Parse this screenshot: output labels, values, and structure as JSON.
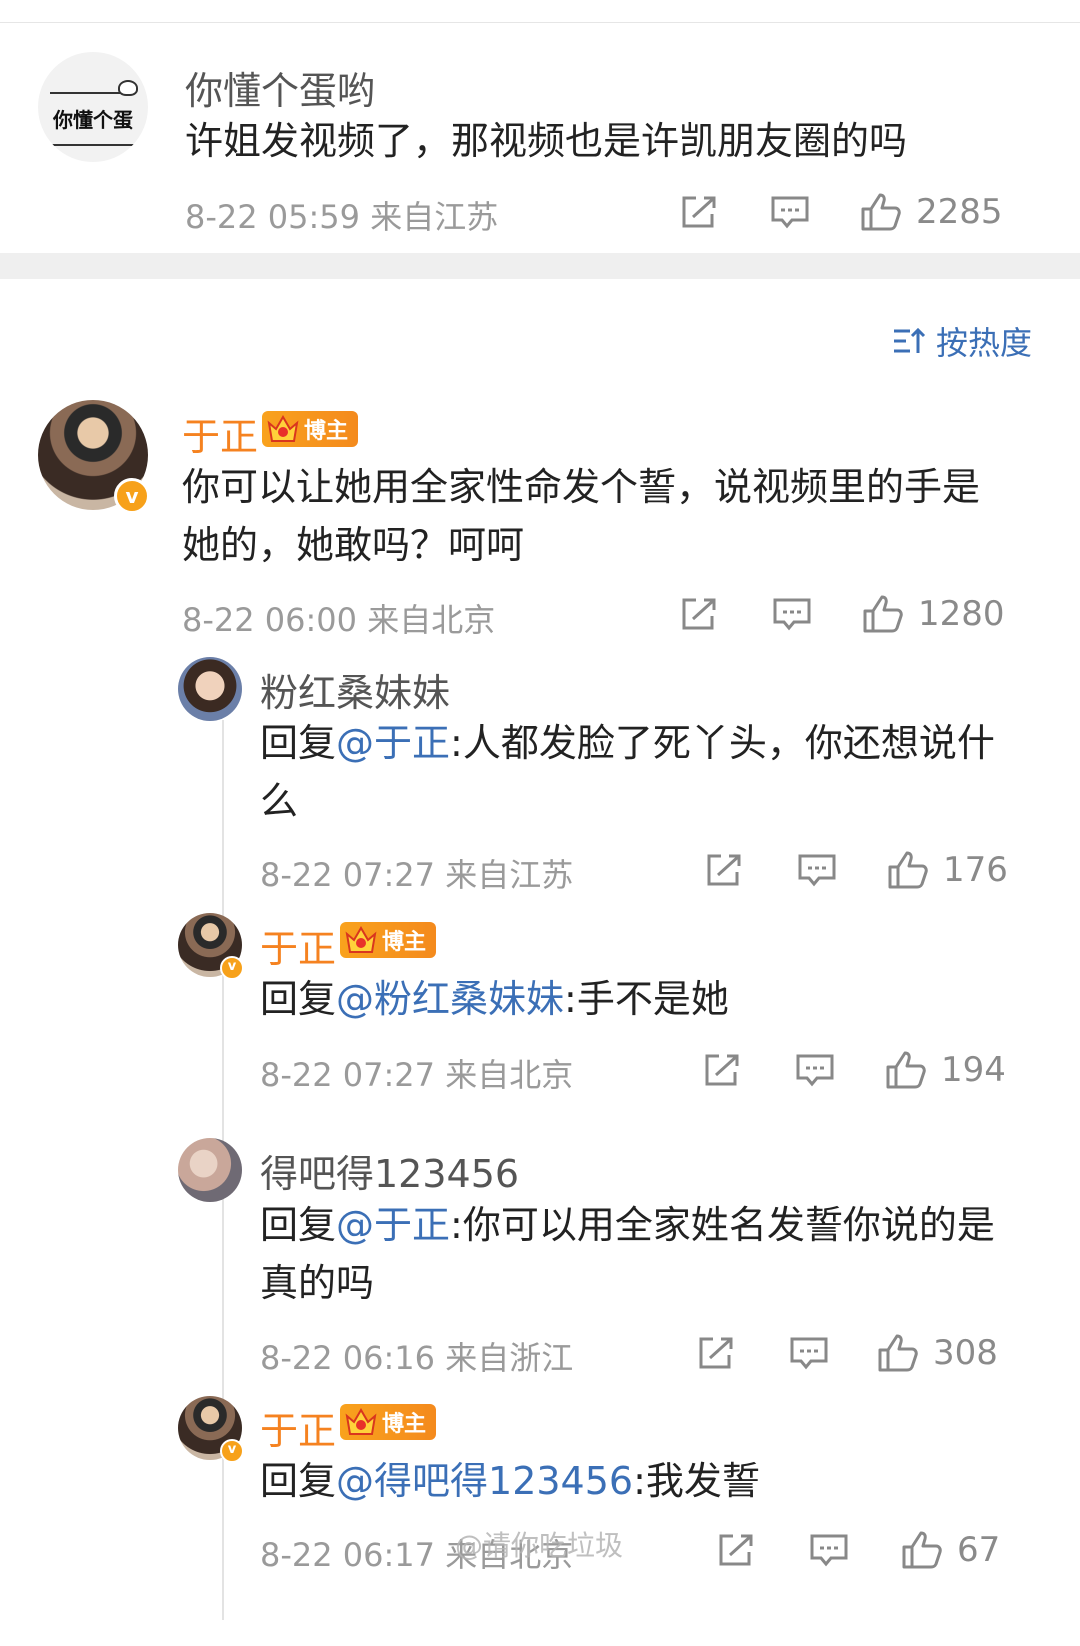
{
  "top_comment": {
    "avatar_text": "你懂个蛋",
    "name": "你懂个蛋哟",
    "text": "许姐发视频了，那视频也是许凯朋友圈的吗",
    "meta": "8-22 05:59  来自江苏",
    "likes": "2285"
  },
  "sort": {
    "label": "按热度"
  },
  "main_comment": {
    "name": "于正",
    "badge": "博主",
    "text": "你可以让她用全家性命发个誓，说视频里的手是她的，她敢吗？呵呵",
    "meta": "8-22 06:00  来自北京",
    "likes": "1280"
  },
  "replies": [
    {
      "name": "粉红桑妹妹",
      "prefix": "回复",
      "mention": "@于正",
      "text": ":人都发脸了死丫头，你还想说什么",
      "meta": "8-22 07:27  来自江苏",
      "likes": "176"
    },
    {
      "name": "于正",
      "badge": "博主",
      "prefix": "回复",
      "mention": "@粉红桑妹妹",
      "text": ":手不是她",
      "meta": "8-22 07:27  来自北京",
      "likes": "194"
    },
    {
      "name": "得吧得123456",
      "prefix": "回复",
      "mention": "@于正",
      "text": ":你可以用全家姓名发誓你说的是真的吗",
      "meta": "8-22 06:16  来自浙江",
      "likes": "308"
    },
    {
      "name": "于正",
      "badge": "博主",
      "prefix": "回复",
      "mention": "@得吧得123456",
      "text": ":我发誓",
      "meta": "8-22 06:17  来自北京",
      "likes": "67"
    }
  ],
  "watermark": "@请你吃垃圾",
  "verified_mark": "v"
}
